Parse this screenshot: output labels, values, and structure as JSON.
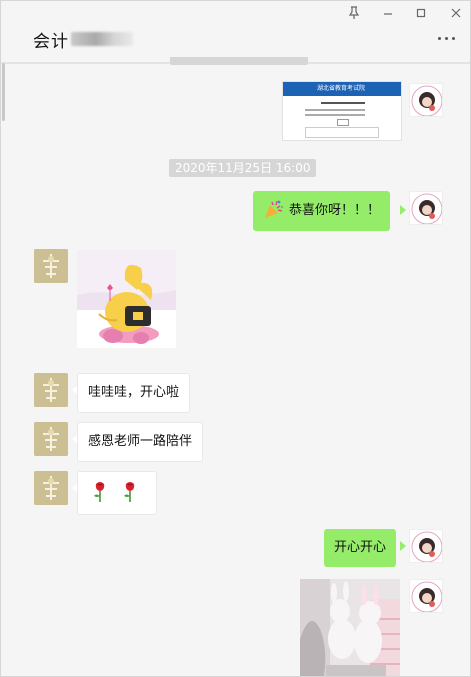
{
  "window": {
    "title": "会计",
    "pin_icon": "pin-icon",
    "minimize_icon": "minimize-icon",
    "maximize_icon": "maximize-icon",
    "close_icon": "close-icon",
    "more_icon": "more-dots-icon"
  },
  "timestamps": {
    "top_partial": "2020年11月25日 16:00",
    "second": "2020年11月25日 16:00"
  },
  "messages": [
    {
      "id": "m1",
      "side": "right",
      "type": "image",
      "image_title": "湖北省教育考试院"
    },
    {
      "id": "m2",
      "side": "right",
      "type": "text",
      "emoji_icon": "party-popper-icon",
      "text": "恭喜你呀！！！"
    },
    {
      "id": "m3",
      "side": "left",
      "type": "sticker"
    },
    {
      "id": "m4",
      "side": "left",
      "type": "text",
      "text": "哇哇哇，开心啦"
    },
    {
      "id": "m5",
      "side": "left",
      "type": "text",
      "text": "感恩老师一路陪伴"
    },
    {
      "id": "m6",
      "side": "left",
      "type": "emoji",
      "emoji_icons": [
        "rose-icon",
        "rose-icon"
      ]
    },
    {
      "id": "m7",
      "side": "right",
      "type": "text",
      "text": "开心开心"
    },
    {
      "id": "m8",
      "side": "right",
      "type": "image"
    }
  ],
  "colors": {
    "self_bubble": "#95ec69",
    "other_bubble": "#ffffff",
    "background": "#f5f5f5"
  }
}
